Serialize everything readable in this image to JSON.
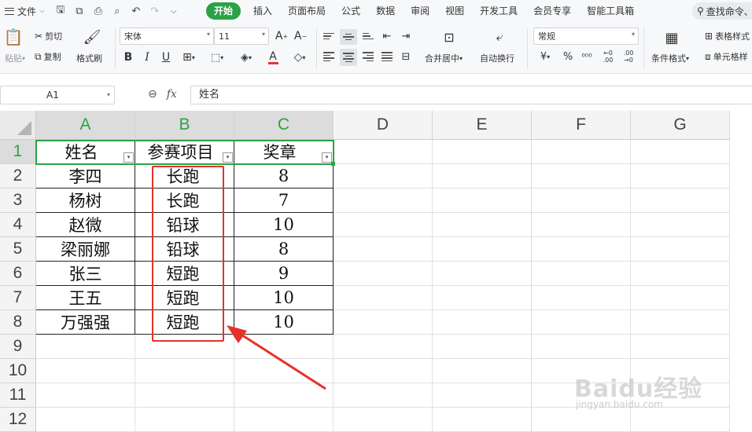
{
  "menubar": {
    "file_label": "文件",
    "tabs": [
      "开始",
      "插入",
      "页面布局",
      "公式",
      "数据",
      "审阅",
      "视图",
      "开发工具",
      "会员专享",
      "智能工具箱"
    ],
    "search_label": "查找命令、"
  },
  "ribbon": {
    "paste_label": "粘贴",
    "cut_label": "剪切",
    "copy_label": "复制",
    "format_painter_label": "格式刷",
    "font_name": "宋体",
    "font_size": "11",
    "merge_center_label": "合并居中",
    "wrap_text_label": "自动换行",
    "number_format": "常规",
    "conditional_format_label": "条件格式",
    "table_style_label": "表格样式",
    "cell_style_label": "单元格样",
    "font_color": "#e6332a",
    "accent": "#2ba245"
  },
  "formula_bar": {
    "name_box": "A1",
    "fx_label": "fx",
    "value": "姓名"
  },
  "grid": {
    "columns": [
      "A",
      "B",
      "C",
      "D",
      "E",
      "F",
      "G"
    ],
    "rows": [
      "1",
      "2",
      "3",
      "4",
      "5",
      "6",
      "7",
      "8",
      "9",
      "10",
      "11",
      "12"
    ],
    "headers": [
      "姓名",
      "参赛项目",
      "奖章"
    ],
    "data": [
      [
        "李四",
        "长跑",
        "8"
      ],
      [
        "杨树",
        "长跑",
        "7"
      ],
      [
        "赵微",
        "铅球",
        "10"
      ],
      [
        "梁丽娜",
        "铅球",
        "8"
      ],
      [
        "张三",
        "短跑",
        "9"
      ],
      [
        "王五",
        "短跑",
        "10"
      ],
      [
        "万强强",
        "短跑",
        "10"
      ]
    ]
  },
  "watermark": {
    "brand": "Baidu经验",
    "url": "jingyan.baidu.com"
  }
}
